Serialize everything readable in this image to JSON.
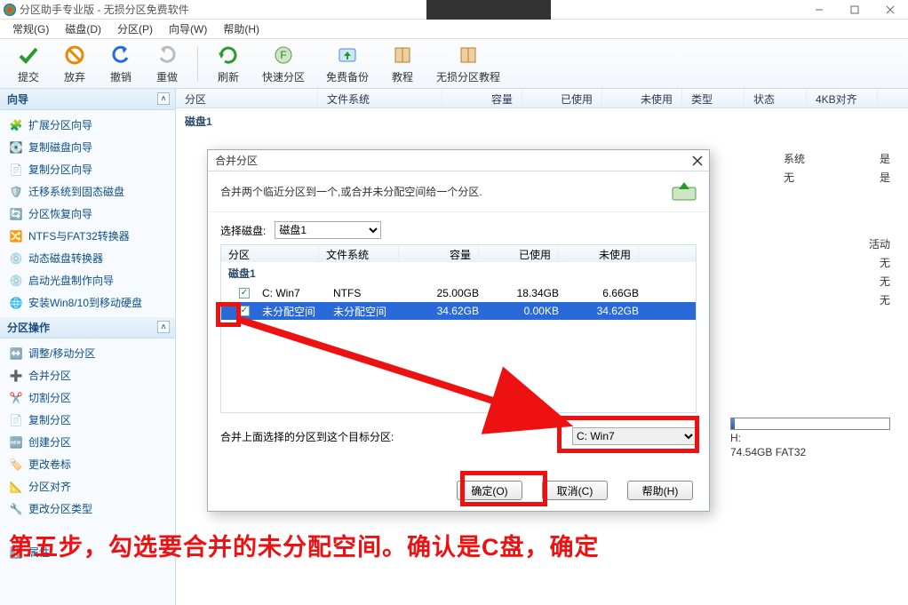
{
  "titlebar": {
    "title": "分区助手专业版 - 无损分区免费软件"
  },
  "menus": [
    "常规(G)",
    "磁盘(D)",
    "分区(P)",
    "向导(W)",
    "帮助(H)"
  ],
  "toolbar": [
    {
      "label": "提交",
      "icon": "commit"
    },
    {
      "label": "放弃",
      "icon": "discard"
    },
    {
      "label": "撤销",
      "icon": "undo"
    },
    {
      "label": "重做",
      "icon": "redo"
    },
    {
      "label": "刷新",
      "icon": "refresh"
    },
    {
      "label": "快速分区",
      "icon": "quick"
    },
    {
      "label": "免费备份",
      "icon": "backup"
    },
    {
      "label": "教程",
      "icon": "book"
    },
    {
      "label": "无损分区教程",
      "icon": "book2"
    }
  ],
  "gridHeaders": {
    "partition": "分区",
    "fs": "文件系统",
    "cap": "容量",
    "used": "已使用",
    "unused": "未使用",
    "type": "类型",
    "status": "状态",
    "align": "4KB对齐"
  },
  "diskTitle": "磁盘1",
  "sidebar": {
    "wizard_title": "向导",
    "wizard_items": [
      "扩展分区向导",
      "复制磁盘向导",
      "复制分区向导",
      "迁移系统到固态磁盘",
      "分区恢复向导",
      "NTFS与FAT32转换器",
      "动态磁盘转换器",
      "启动光盘制作向导",
      "安装Win8/10到移动硬盘"
    ],
    "ops_title": "分区操作",
    "ops_items": [
      "调整/移动分区",
      "合并分区",
      "切割分区",
      "复制分区",
      "创建分区",
      "更改卷标",
      "分区对齐",
      "更改分区类型",
      "",
      "属性"
    ]
  },
  "rightInfo": [
    {
      "k": "系统",
      "v": "是"
    },
    {
      "k": "无",
      "v": "是"
    },
    {
      "k": "",
      "v": ""
    },
    {
      "k": "",
      "v": "活动"
    },
    {
      "k": "",
      "v": "无"
    },
    {
      "k": "",
      "v": "无"
    },
    {
      "k": "",
      "v": "无"
    }
  ],
  "rightBar": {
    "label": "H:",
    "sub": "74.54GB FAT32",
    "pct": 2
  },
  "dialog": {
    "title": "合并分区",
    "desc": "合并两个临近分区到一个,或合并未分配空间给一个分区.",
    "selectDiskLabel": "选择磁盘:",
    "selectDisk": "磁盘1",
    "headers": {
      "p": "分区",
      "fs": "文件系统",
      "cap": "容量",
      "used": "已使用",
      "un": "未使用"
    },
    "diskRow": "磁盘1",
    "rows": [
      {
        "checked": true,
        "p": "C: Win7",
        "fs": "NTFS",
        "cap": "25.00GB",
        "used": "18.34GB",
        "un": "6.66GB",
        "selected": false
      },
      {
        "checked": true,
        "p": "未分配空间",
        "fs": "未分配空间",
        "cap": "34.62GB",
        "used": "0.00KB",
        "un": "34.62GB",
        "selected": true
      }
    ],
    "targetLabel": "合并上面选择的分区到这个目标分区:",
    "target": "C: Win7",
    "ok": "确定(O)",
    "cancel": "取消(C)",
    "help": "帮助(H)"
  },
  "caption": "第五步，勾选要合并的未分配空间。确认是C盘，确定"
}
